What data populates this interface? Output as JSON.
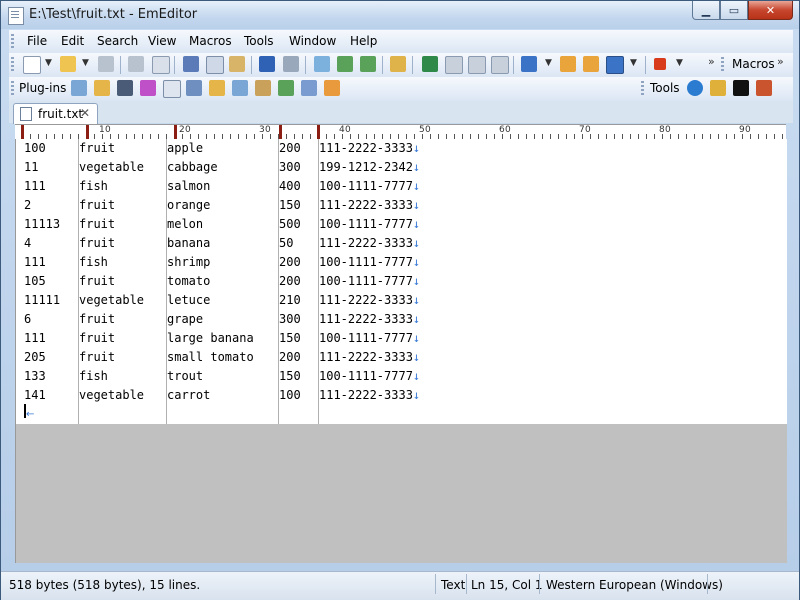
{
  "window": {
    "title": "E:\\Test\\fruit.txt - EmEditor"
  },
  "menu": [
    "File",
    "Edit",
    "Search",
    "View",
    "Macros",
    "Tools",
    "Window",
    "Help"
  ],
  "toolbar1": {
    "macros_label": "Macros"
  },
  "toolbar2": {
    "plugins_label": "Plug-ins",
    "tools_label": "Tools"
  },
  "tab": {
    "name": "fruit.txt"
  },
  "ruler_numbers": [
    "1",
    "0",
    "2",
    "0",
    "3",
    "0",
    "4",
    "0",
    "5",
    "0",
    "6",
    "0",
    "7",
    "0",
    "8",
    "0",
    "9",
    "0"
  ],
  "table": {
    "rows": [
      [
        "100",
        "fruit",
        "apple",
        "200",
        "111-2222-3333↓"
      ],
      [
        "11",
        "vegetable",
        "cabbage",
        "300",
        "199-1212-2342↓"
      ],
      [
        "111",
        "fish",
        "salmon",
        "400",
        "100-1111-7777↓"
      ],
      [
        "2",
        "fruit",
        "orange",
        "150",
        "111-2222-3333↓"
      ],
      [
        "11113",
        "fruit",
        "melon",
        "500",
        "100-1111-7777↓"
      ],
      [
        "4",
        "fruit",
        "banana",
        "50",
        "111-2222-3333↓"
      ],
      [
        "111",
        "fish",
        "shrimp",
        "200",
        "100-1111-7777↓"
      ],
      [
        "105",
        "fruit",
        "tomato",
        "200",
        "100-1111-7777↓"
      ],
      [
        "11111",
        "vegetable",
        "letuce",
        "210",
        "111-2222-3333↓"
      ],
      [
        "6",
        "fruit",
        "grape",
        "300",
        "111-2222-3333↓"
      ],
      [
        "111",
        "fruit",
        "large banana",
        "150",
        "100-1111-7777↓"
      ],
      [
        "205",
        "fruit",
        "small tomato",
        "200",
        "111-2222-3333↓"
      ],
      [
        "133",
        "fish",
        "trout",
        "150",
        "100-1111-7777↓"
      ],
      [
        "141",
        "vegetable",
        "carrot",
        "100",
        "111-2222-3333↓"
      ]
    ]
  },
  "status": {
    "info": "518 bytes (518 bytes), 15 lines.",
    "mode": "Text",
    "position": "Ln 15, Col 1",
    "encoding": "Western European (Windows)"
  },
  "colors": {
    "eol_marker": "#3a7bd5",
    "ruler_marker": "#8b1d12"
  }
}
